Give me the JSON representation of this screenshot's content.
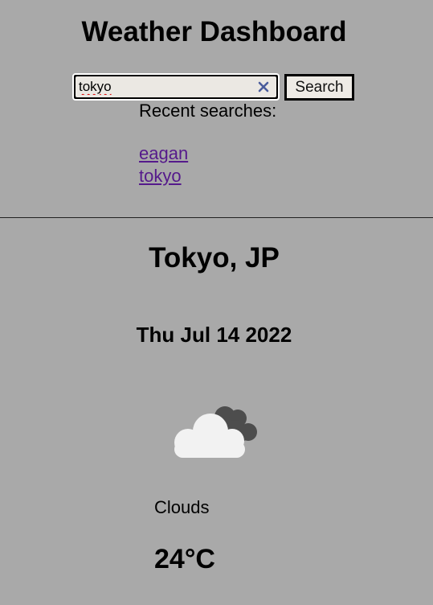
{
  "header": {
    "title": "Weather Dashboard"
  },
  "search": {
    "value": "tokyo",
    "button_label": "Search",
    "clear_icon": "close-icon"
  },
  "recent": {
    "label": "Recent searches:",
    "items": [
      "eagan",
      "tokyo"
    ]
  },
  "current": {
    "location": "Tokyo, JP",
    "date": "Thu Jul 14 2022",
    "icon": "cloud-icon",
    "condition": "Clouds",
    "temperature": "24°C"
  },
  "colors": {
    "background": "#a9a9a9",
    "link": "#551a8b",
    "clear_icon": "#4a5c9c",
    "input_bg": "#ebe8e3",
    "cloud_front": "#f2f2f2",
    "cloud_back": "#4d4d4d"
  }
}
